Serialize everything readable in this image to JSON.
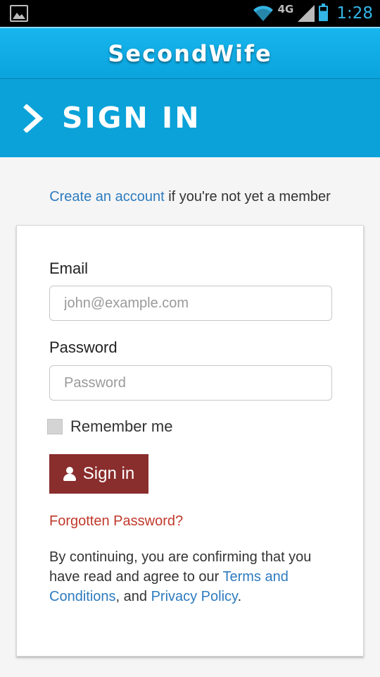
{
  "status_bar": {
    "time": "1:28",
    "network": "4G",
    "icons": [
      "gallery-icon",
      "wifi-icon",
      "4g-lte-icon",
      "signal-icon",
      "battery-icon"
    ],
    "accent": "#33b5e5"
  },
  "app_bar": {
    "title": "SecondWife",
    "color": "#0aa3dd"
  },
  "banner": {
    "title": "SIGN IN",
    "icon": "chevron-right-icon",
    "color": "#0aa2d8"
  },
  "create_account": {
    "link_text": "Create an account",
    "suffix": " if you're not yet a member"
  },
  "form": {
    "email_label": "Email",
    "email_placeholder": "john@example.com",
    "email_value": "",
    "password_label": "Password",
    "password_placeholder": "Password",
    "password_value": "",
    "remember_label": "Remember me",
    "remember_checked": false,
    "submit_label": "Sign in",
    "submit_icon": "user-icon",
    "submit_color": "#8a2d2d",
    "forgot_label": "Forgotten Password?",
    "forgot_color": "#c0392b"
  },
  "terms": {
    "prefix": "By continuing, you are confirming that you have read and agree to our ",
    "terms_link": "Terms and Conditions",
    "middle": ", and ",
    "privacy_link": "Privacy Policy",
    "suffix": "."
  }
}
